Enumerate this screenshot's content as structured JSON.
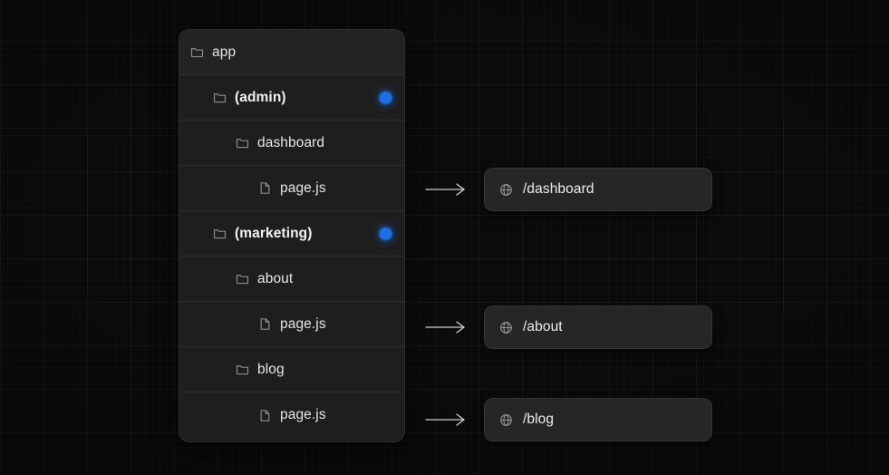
{
  "canvas": {
    "background_color": "#0a0a0a",
    "grid": "dot-grid-dark"
  },
  "file_tree": {
    "card_background": "#1d1d1d",
    "rows": [
      {
        "label": "app",
        "icon": "folder-icon",
        "indent": 0,
        "type": "folder",
        "group": false,
        "dot": false
      },
      {
        "label": "(admin)",
        "icon": "folder-icon",
        "indent": 1,
        "type": "folder",
        "group": true,
        "dot": true
      },
      {
        "label": "dashboard",
        "icon": "folder-icon",
        "indent": 2,
        "type": "folder",
        "group": false,
        "dot": false
      },
      {
        "label": "page.js",
        "icon": "file-icon",
        "indent": 3,
        "type": "file",
        "group": false,
        "dot": false
      },
      {
        "label": "(marketing)",
        "icon": "folder-icon",
        "indent": 1,
        "type": "folder",
        "group": true,
        "dot": true
      },
      {
        "label": "about",
        "icon": "folder-icon",
        "indent": 2,
        "type": "folder",
        "group": false,
        "dot": false
      },
      {
        "label": "page.js",
        "icon": "file-icon",
        "indent": 3,
        "type": "file",
        "group": false,
        "dot": false
      },
      {
        "label": "blog",
        "icon": "folder-icon",
        "indent": 2,
        "type": "folder",
        "group": false,
        "dot": false
      },
      {
        "label": "page.js",
        "icon": "file-icon",
        "indent": 3,
        "type": "file",
        "group": false,
        "dot": false
      }
    ],
    "group_dot_color": "#1c6fe6"
  },
  "routes": [
    {
      "path": "/dashboard",
      "icon": "globe-icon",
      "arrow": "long-right-arrow-icon",
      "source_row": 3
    },
    {
      "path": "/about",
      "icon": "globe-icon",
      "arrow": "long-right-arrow-icon",
      "source_row": 6
    },
    {
      "path": "/blog",
      "icon": "globe-icon",
      "arrow": "long-right-arrow-icon",
      "source_row": 8
    }
  ]
}
